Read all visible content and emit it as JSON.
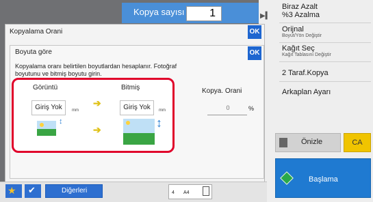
{
  "header": {
    "copies_label": "Kopya sayısı",
    "copies_value": "1"
  },
  "right_menu": [
    {
      "title": "Biraz Azalt",
      "subtitle": "%3 Azalma"
    },
    {
      "title": "Orijnal",
      "subtitle": "Boyut/Yön Değiştir"
    },
    {
      "title": "Kağıt Seç",
      "subtitle": "Kağıt Tablasını Değiştir"
    },
    {
      "title": "2 Taraf.Kopya",
      "subtitle": ""
    },
    {
      "title": "Arkaplan Ayarı",
      "subtitle": ""
    }
  ],
  "buttons": {
    "preview": "Önizle",
    "ca": "CA",
    "start": "Başlama"
  },
  "dialog": {
    "outer_title": "Kopyalama Orani",
    "ok": "OK",
    "inner_title": "Boyuta göre",
    "description": "Kopyalama oranı belirtilen boyutlardan hesaplanır. Fotoğraf boyutunu ve bitmiş boyutu girin.",
    "source_label": "Görüntü",
    "finished_label": "Bitmiş",
    "source_value": "Giriş Yok",
    "finished_value": "Giriş Yok",
    "unit": "mm",
    "ratio_label": "Kopya. Orani",
    "ratio_value": "0",
    "ratio_unit": "%"
  },
  "bottom": {
    "others_label": "Diğerleri",
    "paper_count": "4",
    "paper_size": "A4"
  },
  "colors": {
    "accent_blue": "#1e66d0",
    "highlight_red": "#e0002a",
    "ca_yellow": "#f0c400",
    "start_blue": "#1f7ad1"
  }
}
